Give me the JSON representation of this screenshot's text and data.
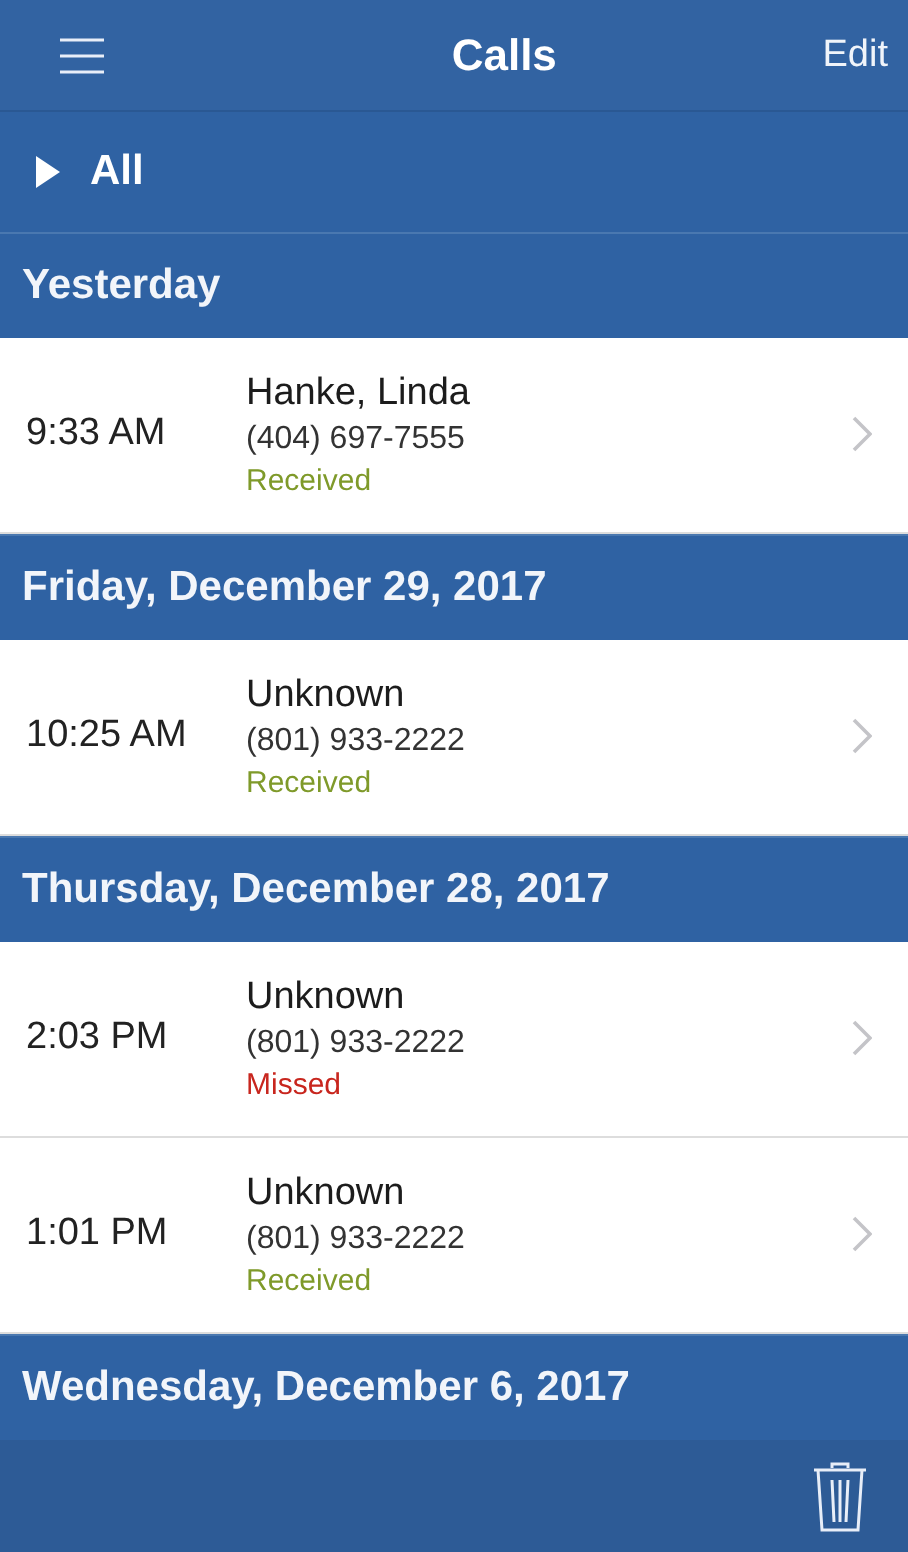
{
  "header": {
    "title": "Calls",
    "action": "Edit"
  },
  "filter": {
    "label": "All",
    "expanded": false
  },
  "sections": [
    {
      "title": "Yesterday",
      "calls": [
        {
          "time": "9:33 AM",
          "name": "Hanke, Linda",
          "phone": "(404) 697-7555",
          "status": "Received",
          "kind": "received"
        }
      ]
    },
    {
      "title": "Friday, December 29, 2017",
      "calls": [
        {
          "time": "10:25 AM",
          "name": "Unknown",
          "phone": "(801) 933-2222",
          "status": "Received",
          "kind": "received"
        }
      ]
    },
    {
      "title": "Thursday, December 28, 2017",
      "calls": [
        {
          "time": "2:03 PM",
          "name": "Unknown",
          "phone": "(801) 933-2222",
          "status": "Missed",
          "kind": "missed"
        },
        {
          "time": "1:01 PM",
          "name": "Unknown",
          "phone": "(801) 933-2222",
          "status": "Received",
          "kind": "received"
        }
      ]
    },
    {
      "title": "Wednesday, December 6, 2017"
    }
  ]
}
